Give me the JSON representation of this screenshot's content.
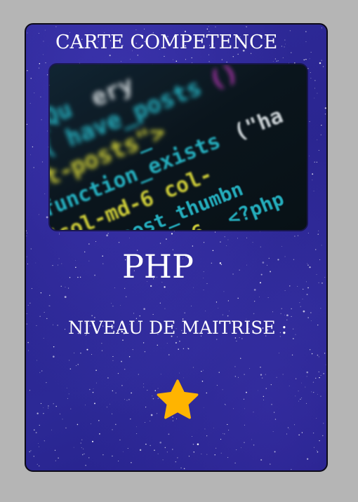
{
  "card": {
    "heading": "CARTE COMPETENCE",
    "image_icon": "code-editor-photo",
    "skill": "PHP",
    "mastery_label": "NIVEAU DE MAITRISE :",
    "mastery_level": 1,
    "mastery_icon": "star-icon",
    "colors": {
      "card_background": "#2c2894",
      "page_background": "#b5b5b5",
      "text": "#ffffff",
      "star": "#ffb400"
    }
  }
}
